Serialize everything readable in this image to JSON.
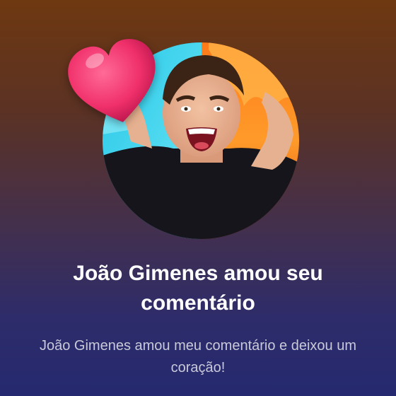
{
  "notification": {
    "title": "João Gimenes amou seu comentário",
    "message": "João Gimenes amou meu comentário e deixou um coração!"
  },
  "avatar": {
    "icon": "user-photo-avatar"
  },
  "reaction": {
    "icon": "heart-icon",
    "color": "#f0306a"
  },
  "colors": {
    "background_top": "#6e3811",
    "background_bottom": "#25296f",
    "title_text": "#ffffff",
    "message_text": "#c9c9d9"
  }
}
